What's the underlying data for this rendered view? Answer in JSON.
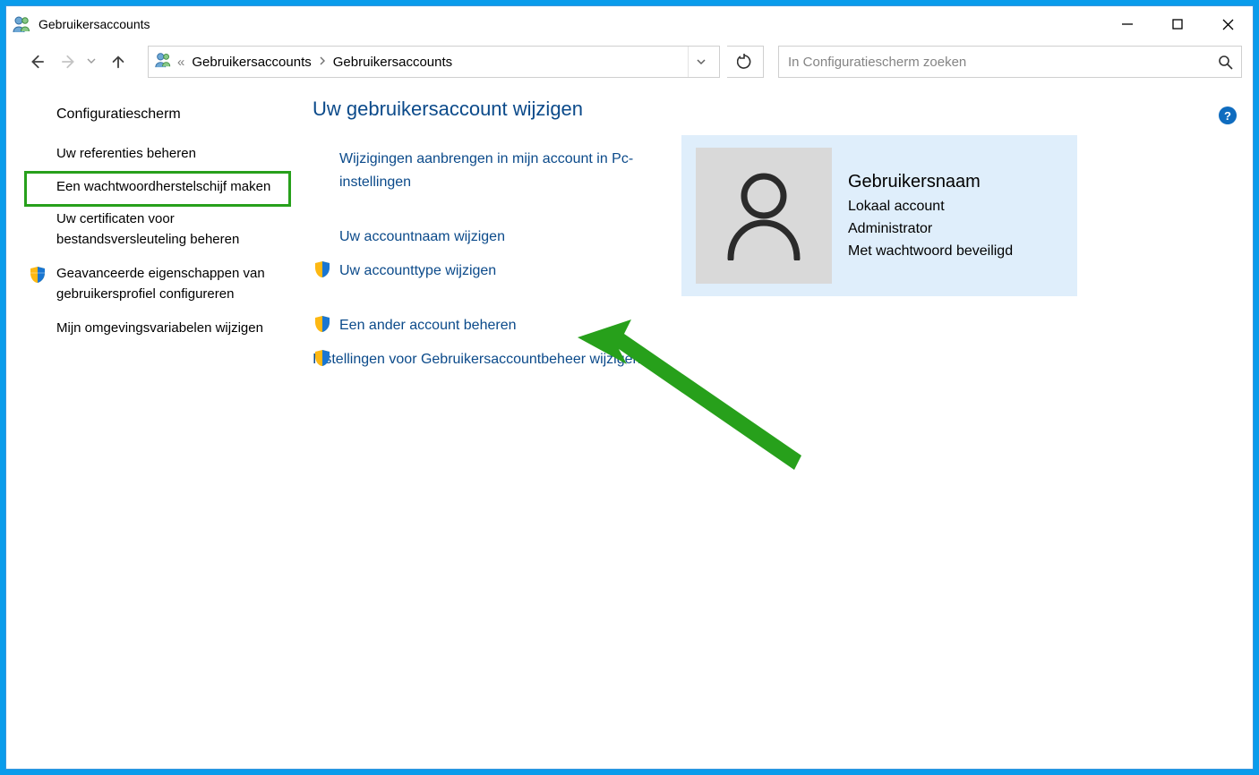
{
  "window": {
    "title": "Gebruikersaccounts"
  },
  "breadcrumbs": {
    "prefix": "«",
    "item1": "Gebruikersaccounts",
    "item2": "Gebruikersaccounts"
  },
  "search": {
    "placeholder": "In Configuratiescherm zoeken"
  },
  "help": {
    "glyph": "?"
  },
  "sidebar": {
    "home": "Configuratiescherm",
    "items": [
      "Uw referenties beheren",
      "Een wachtwoordherstelschijf maken",
      "Uw certificaten voor bestandsversleuteling beheren",
      "Geavanceerde eigenschappen van gebruikersprofiel configureren",
      "Mijn omgevingsvariabelen wijzigen"
    ]
  },
  "main": {
    "heading": "Uw gebruikersaccount wijzigen",
    "actions": {
      "pc_settings": "Wijzigingen aanbrengen in mijn account in Pc-instellingen",
      "change_name": "Uw accountnaam wijzigen",
      "change_type": "Uw accounttype wijzigen",
      "manage_other": "Een ander account beheren",
      "uac_settings": "Instellingen voor Gebruikersaccountbeheer wijzigen"
    }
  },
  "account": {
    "name": "Gebruikersnaam",
    "type": "Lokaal account",
    "role": "Administrator",
    "protection": "Met wachtwoord beveiligd"
  }
}
